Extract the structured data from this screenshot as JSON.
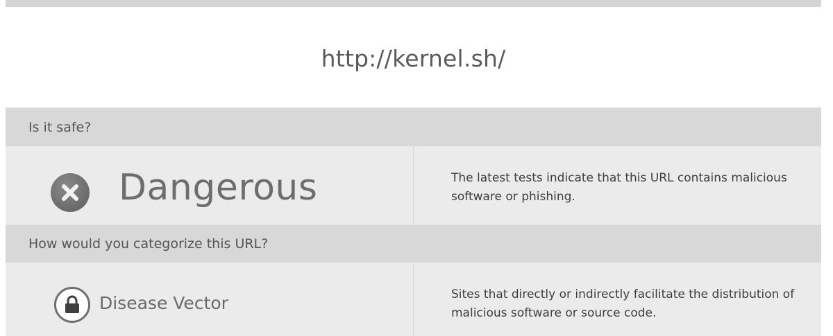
{
  "url": "http://kernel.sh/",
  "safety": {
    "heading": "Is it safe?",
    "verdict": "Dangerous",
    "verdict_icon": "x-circle-icon",
    "description": "The latest tests indicate that this URL contains malicious software or phishing."
  },
  "category": {
    "heading": "How would you categorize this URL?",
    "name": "Disease Vector",
    "category_icon": "lock-icon",
    "description": "Sites that directly or indirectly facilitate the distribution of malicious software or source code."
  },
  "colors": {
    "section_header_bg": "#d9d8d8",
    "row_bg": "#ebebeb",
    "icon_gray": "#6a6a6a"
  }
}
